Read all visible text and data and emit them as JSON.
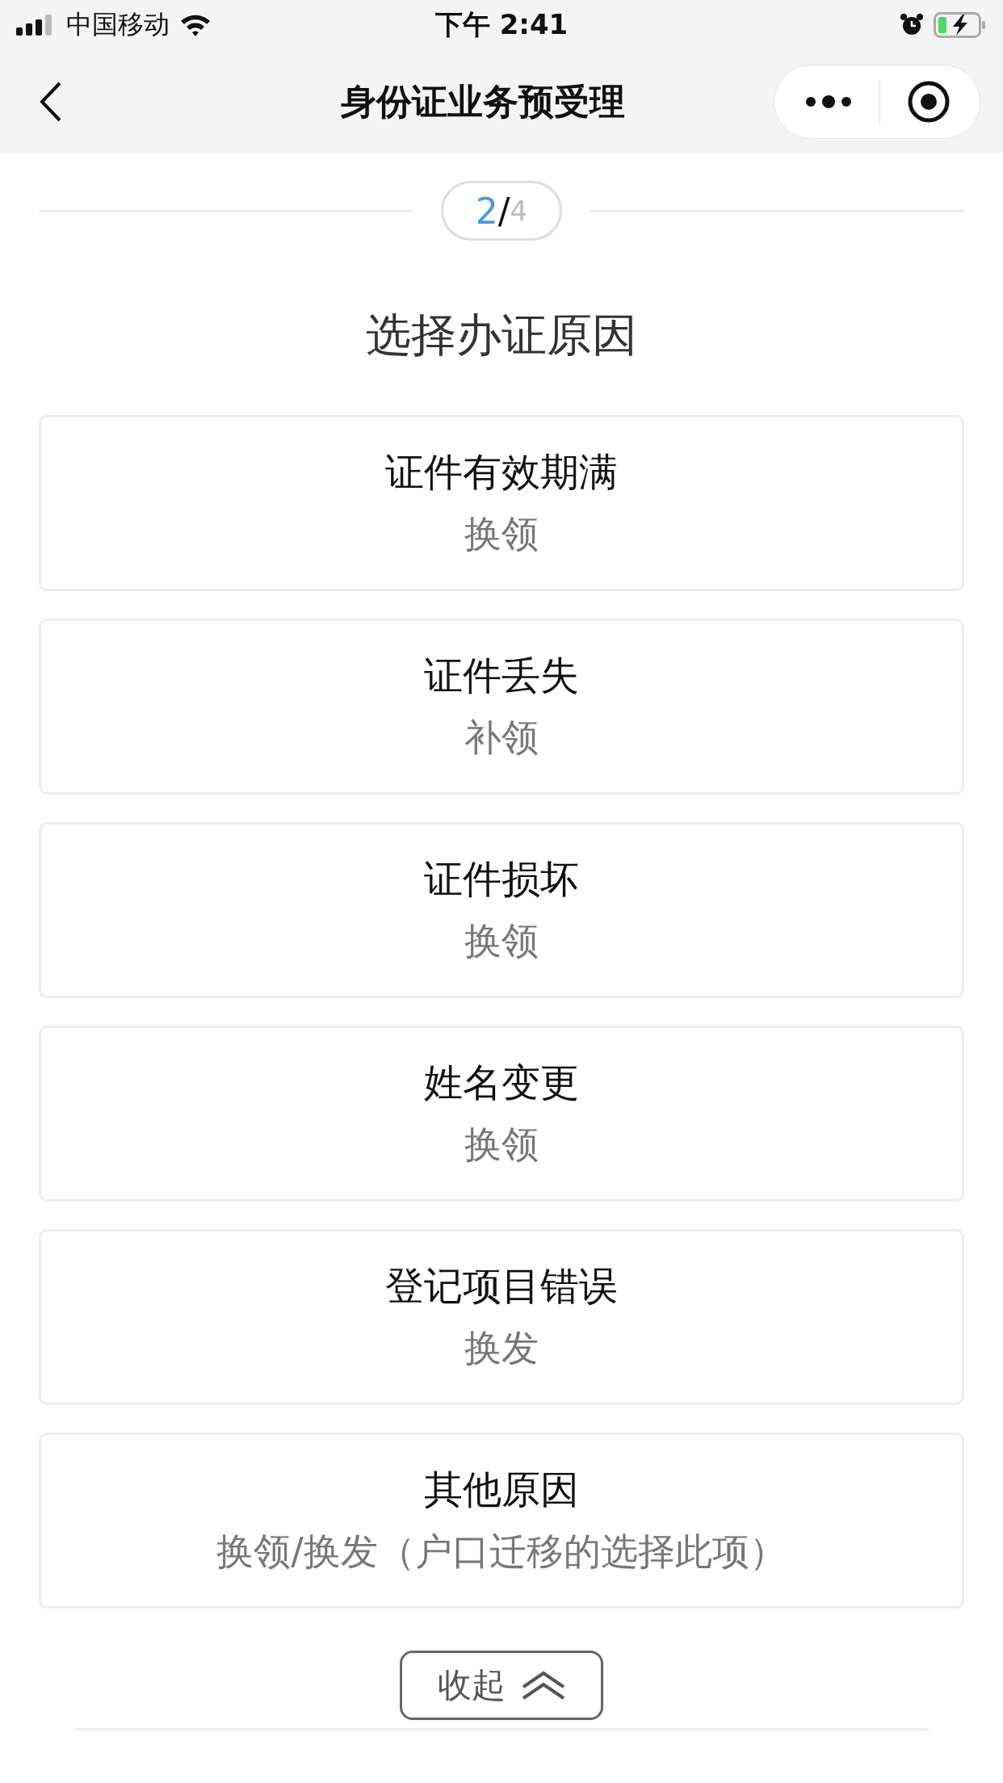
{
  "status_bar": {
    "carrier": "中国移动",
    "time": "下午 2:41"
  },
  "nav": {
    "title": "身份证业务预受理"
  },
  "step": {
    "current": "2",
    "separator": "/",
    "total": "4"
  },
  "heading": "选择办证原因",
  "reasons": [
    {
      "title": "证件有效期满",
      "action": "换领"
    },
    {
      "title": "证件丢失",
      "action": "补领"
    },
    {
      "title": "证件损坏",
      "action": "换领"
    },
    {
      "title": "姓名变更",
      "action": "换领"
    },
    {
      "title": "登记项目错误",
      "action": "换发"
    },
    {
      "title": "其他原因",
      "action": "换领/换发（户口迁移的选择此项）"
    }
  ],
  "collapse_button": {
    "label": "收起"
  }
}
